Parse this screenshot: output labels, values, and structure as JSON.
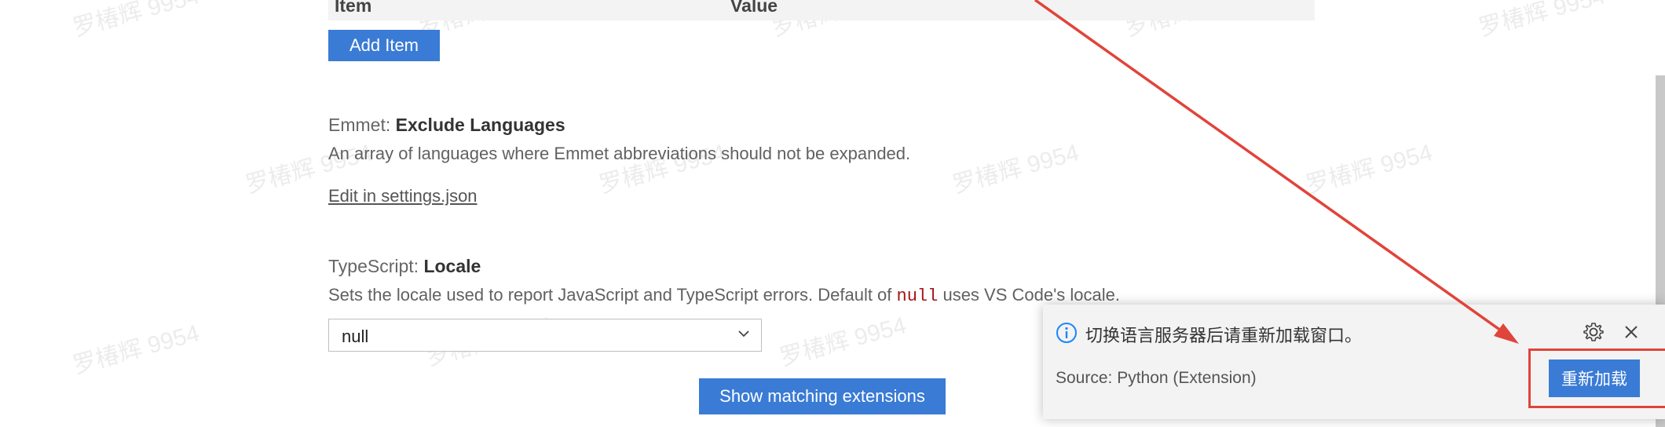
{
  "table": {
    "col_item": "Item",
    "col_value": "Value",
    "add_button": "Add Item"
  },
  "emmet": {
    "prefix": "Emmet: ",
    "name": "Exclude Languages",
    "description": "An array of languages where Emmet abbreviations should not be expanded.",
    "edit_link": "Edit in settings.json"
  },
  "typescript": {
    "prefix": "TypeScript: ",
    "name": "Locale",
    "desc_before": "Sets the locale used to report JavaScript and TypeScript errors. Default of ",
    "desc_code": "null",
    "desc_after": " uses VS Code's locale.",
    "select_value": "null"
  },
  "show_extensions_button": "Show matching extensions",
  "notification": {
    "message": "切换语言服务器后请重新加载窗口。",
    "source": "Source: Python (Extension)",
    "action_button": "重新加载",
    "icon": "info-icon"
  },
  "watermark_text": "罗椿辉 9954",
  "colors": {
    "primary_button": "#3a7bd5",
    "annotation_red": "#e0443a",
    "code_red": "#a31515"
  }
}
